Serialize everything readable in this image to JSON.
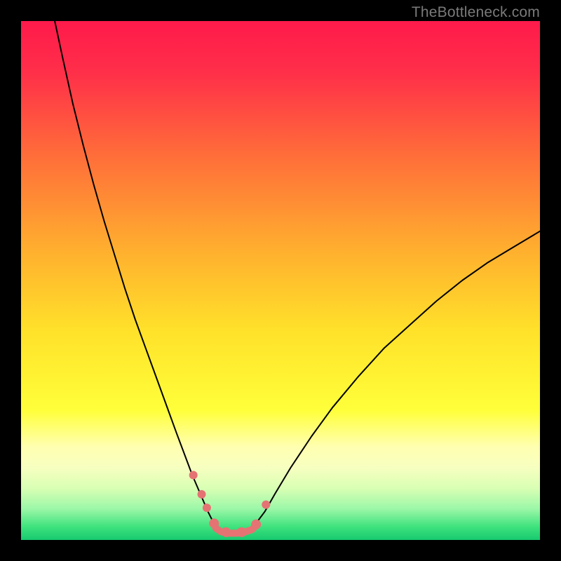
{
  "watermark": "TheBottleneck.com",
  "chart_data": {
    "type": "line",
    "title": "",
    "xlabel": "",
    "ylabel": "",
    "xlim": [
      0,
      100
    ],
    "ylim": [
      0,
      100
    ],
    "background": {
      "type": "vertical-gradient",
      "stops": [
        {
          "pos": 0.0,
          "color": "#ff1a4b"
        },
        {
          "pos": 0.1,
          "color": "#ff2f49"
        },
        {
          "pos": 0.25,
          "color": "#ff6a3a"
        },
        {
          "pos": 0.45,
          "color": "#ffb22e"
        },
        {
          "pos": 0.6,
          "color": "#ffe22a"
        },
        {
          "pos": 0.75,
          "color": "#ffff3a"
        },
        {
          "pos": 0.82,
          "color": "#ffffb0"
        },
        {
          "pos": 0.86,
          "color": "#f7ffc0"
        },
        {
          "pos": 0.9,
          "color": "#d9ffb4"
        },
        {
          "pos": 0.94,
          "color": "#9cf7a8"
        },
        {
          "pos": 0.975,
          "color": "#3de27d"
        },
        {
          "pos": 1.0,
          "color": "#18c96f"
        }
      ]
    },
    "series": [
      {
        "name": "left-branch",
        "stroke": "#000000",
        "stroke_width": 2,
        "x": [
          6.5,
          8,
          10,
          12,
          14,
          16,
          18,
          20,
          22,
          24,
          26,
          28,
          30,
          31.5,
          33,
          34.5,
          36,
          37
        ],
        "y": [
          100,
          93,
          84,
          76,
          68.5,
          61.5,
          55,
          48.5,
          42.5,
          37,
          31.5,
          26,
          20.5,
          16.5,
          12.5,
          9,
          5.5,
          3.5
        ]
      },
      {
        "name": "right-branch",
        "stroke": "#000000",
        "stroke_width": 2,
        "x": [
          45.5,
          47,
          49,
          52,
          56,
          60,
          65,
          70,
          75,
          80,
          85,
          90,
          95,
          100
        ],
        "y": [
          3.5,
          5.5,
          9,
          14,
          20,
          25.5,
          31.5,
          37,
          41.5,
          46,
          50,
          53.5,
          56.5,
          59.5
        ]
      },
      {
        "name": "optimal-flat",
        "stroke": "#e57373",
        "stroke_width": 10,
        "x": [
          37.5,
          38.5,
          40,
          41.5,
          43,
          44.5,
          45.3
        ],
        "y": [
          2.3,
          1.6,
          1.3,
          1.3,
          1.5,
          2.0,
          2.8
        ]
      }
    ],
    "markers": [
      {
        "x": 33.2,
        "y": 12.5,
        "r": 6,
        "color": "#e57373"
      },
      {
        "x": 34.8,
        "y": 8.8,
        "r": 6,
        "color": "#e57373"
      },
      {
        "x": 35.8,
        "y": 6.2,
        "r": 6,
        "color": "#e57373"
      },
      {
        "x": 37.2,
        "y": 3.2,
        "r": 7,
        "color": "#e57373"
      },
      {
        "x": 39.5,
        "y": 1.5,
        "r": 7,
        "color": "#e57373"
      },
      {
        "x": 42.5,
        "y": 1.5,
        "r": 7,
        "color": "#e57373"
      },
      {
        "x": 45.3,
        "y": 3.0,
        "r": 7,
        "color": "#e57373"
      },
      {
        "x": 47.2,
        "y": 6.8,
        "r": 6,
        "color": "#e57373"
      }
    ]
  }
}
